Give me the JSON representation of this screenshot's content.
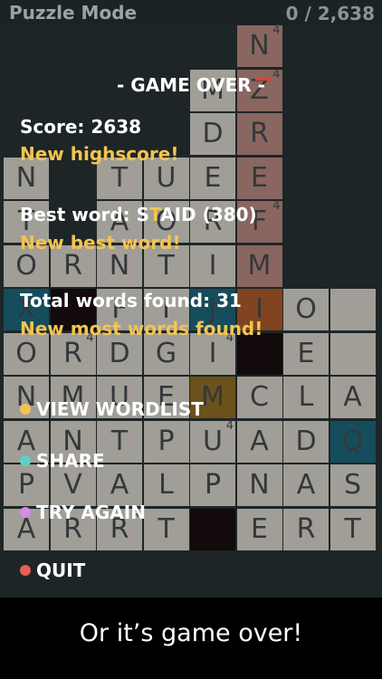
{
  "header": {
    "mode_label": "Puzzle Mode",
    "score_label": "0 / 2,638"
  },
  "board": {
    "rows": [
      [
        "",
        "",
        "",
        "",
        "",
        "N",
        "",
        ""
      ],
      [
        "",
        "",
        "",
        "",
        "M",
        "Z",
        "",
        ""
      ],
      [
        "",
        "",
        "",
        "",
        "D",
        "R",
        "",
        ""
      ],
      [
        "N",
        "",
        "T",
        "U",
        "E",
        "E",
        "",
        ""
      ],
      [
        "T",
        "",
        "A",
        "O",
        "R",
        "F",
        "",
        ""
      ],
      [
        "O",
        "R",
        "N",
        "T",
        "I",
        "M",
        "",
        ""
      ],
      [
        "X",
        "",
        "F",
        "I",
        "J",
        "I",
        "O",
        ""
      ],
      [
        "O",
        "R",
        "D",
        "G",
        "I",
        "",
        "E",
        ""
      ],
      [
        "N",
        "M",
        "U",
        "E",
        "M",
        "C",
        "L",
        "A"
      ],
      [
        "A",
        "N",
        "T",
        "P",
        "U",
        "A",
        "D",
        "Q"
      ],
      [
        "P",
        "V",
        "A",
        "L",
        "P",
        "N",
        "A",
        "S"
      ],
      [
        "A",
        "R",
        "R",
        "T",
        "",
        "E",
        "R",
        "T"
      ]
    ],
    "bonus_marks": [
      "4",
      "4",
      "4",
      "4",
      "4",
      "4",
      "4"
    ],
    "colors": {
      "tile_light": "#e6e2d8",
      "tile_teal": "#1f6f86",
      "tile_orange": "#b8622e",
      "tile_dark": "#1a0f10",
      "tile_gold": "#9a7428",
      "tile_pink": "#c4928a"
    }
  },
  "game_over": {
    "title": "- GAME OVER -",
    "score_label": "Score:",
    "score_value": "2638",
    "new_highscore": "New highscore!",
    "best_word_label": "Best word:",
    "best_word_prefix": "S",
    "best_word_highlight": "T",
    "best_word_rest": "AID",
    "best_word_points": "(380)",
    "new_best_word": "New best word!",
    "total_words_label": "Total words found:",
    "total_words_value": "31",
    "new_most_words": "New most words found!"
  },
  "menu": {
    "view_wordlist": "VIEW WORDLIST",
    "share": "SHARE",
    "try_again": "TRY AGAIN",
    "quit": "QUIT",
    "dot_colors": {
      "view_wordlist": "#f3c451",
      "share": "#5fd1c4",
      "try_again": "#d58be8",
      "quit": "#e3605a"
    }
  },
  "footer": {
    "caption": "Or it’s game over!"
  }
}
